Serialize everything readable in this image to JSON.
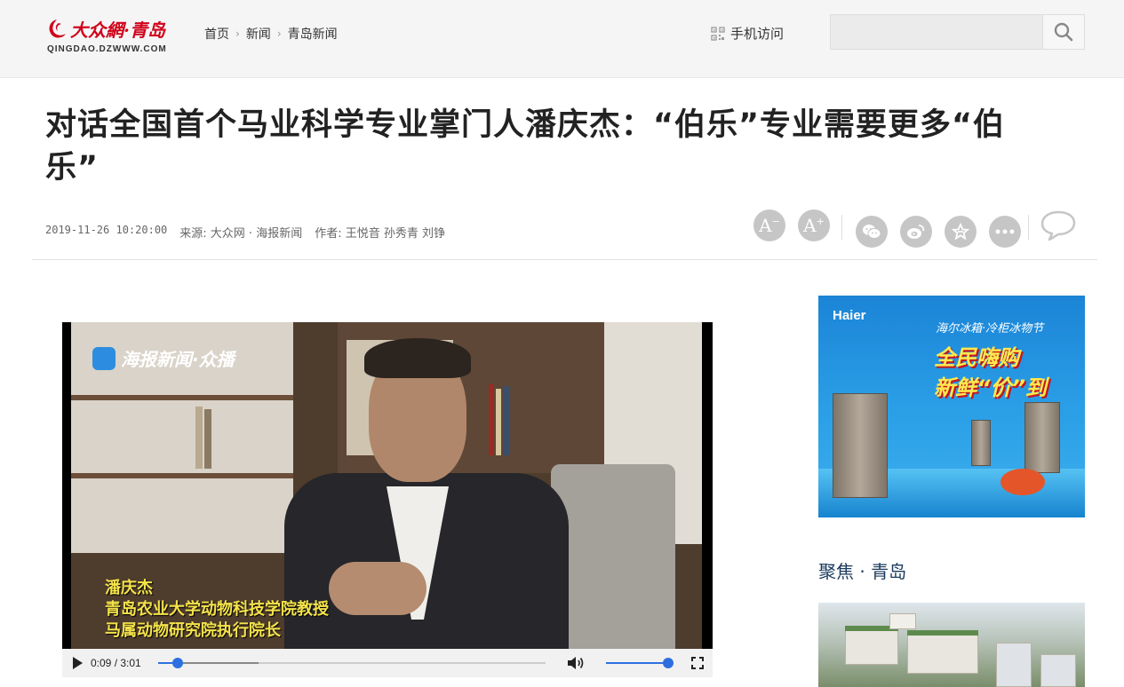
{
  "header": {
    "logo_text": "大众網·青岛",
    "logo_sub": "QINGDAO.DZWWW.COM",
    "breadcrumbs": [
      "首页",
      "新闻",
      "青岛新闻"
    ],
    "mobile_label": "手机访问",
    "search_placeholder": ""
  },
  "article": {
    "title_line1": "对话全国首个马业科学专业掌门人潘庆杰：“伯乐”专业需要更多“伯",
    "title_line2": "乐”",
    "date": "2019-11-26 10:20:00",
    "source": "来源: 大众网 · 海报新闻",
    "author": "作者: 王悦音 孙秀青 刘铮"
  },
  "tools": {
    "font_smaller": "A",
    "font_larger": "A",
    "share_icons": [
      "wechat-icon",
      "weibo-icon",
      "favorite-icon",
      "more-icon",
      "comment-icon"
    ]
  },
  "video": {
    "watermark": "海报新闻·众播",
    "caption_lines": [
      "潘庆杰",
      "青岛农业大学动物科技学院教授",
      "马属动物研究院执行院长"
    ],
    "time": "0:09 / 3:01",
    "progress": 0.05,
    "buffered": 0.26,
    "volume": 1.0
  },
  "ad": {
    "brand": "Haier",
    "tagline": "海尔冰箱·冷柜冰物节",
    "headline1": "全民嗨购",
    "headline2": "新鲜“价”到"
  },
  "sidebar": {
    "focus_title": "聚焦 · 青岛"
  },
  "colors": {
    "brand_red": "#d0021b",
    "accent_blue": "#2e6fe0",
    "caption_yellow": "#f5e34a"
  }
}
